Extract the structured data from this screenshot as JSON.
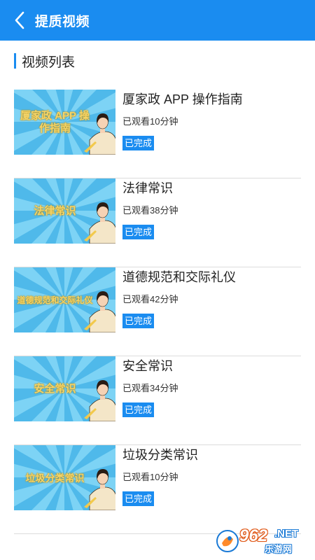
{
  "header": {
    "title": "提质视频"
  },
  "section": {
    "title": "视频列表"
  },
  "videos": [
    {
      "title": "厦家政 APP 操作指南",
      "thumb_text": "厦家政 APP 操作指南",
      "watched": "已观看10分钟",
      "status": "已完成"
    },
    {
      "title": "法律常识",
      "thumb_text": "法律常识",
      "watched": "已观看38分钟",
      "status": "已完成"
    },
    {
      "title": "道德规范和交际礼仪",
      "thumb_text": "道德规范和交际礼仪",
      "watched": "已观看42分钟",
      "status": "已完成"
    },
    {
      "title": "安全常识",
      "thumb_text": "安全常识",
      "watched": "已观看34分钟",
      "status": "已完成"
    },
    {
      "title": "垃圾分类常识",
      "thumb_text": "垃圾分类常识",
      "watched": "已观看10分钟",
      "status": "已完成"
    }
  ],
  "watermark": {
    "number": "962",
    "suffix": ".NET",
    "caption": "乐游网"
  },
  "colors": {
    "primary": "#1a8cf0",
    "thumb_bg": "#5fc3ef",
    "thumb_text": "#f3d46a"
  }
}
